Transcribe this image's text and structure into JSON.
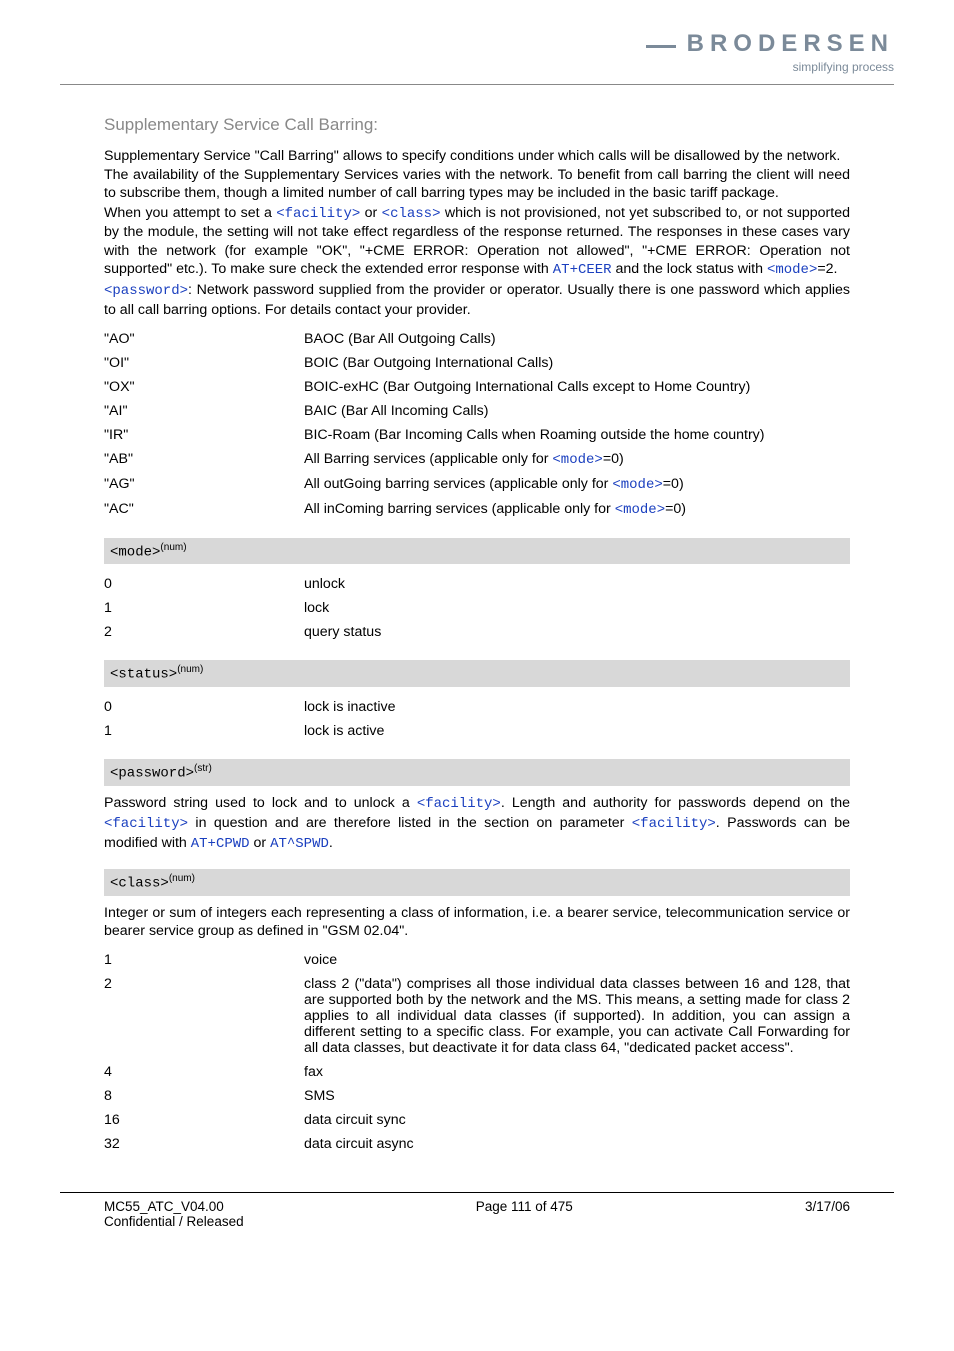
{
  "header": {
    "logo_text": "BRODERSEN",
    "tagline": "simplifying process"
  },
  "section": {
    "title": "Supplementary Service Call Barring:",
    "para1": "Supplementary Service \"Call Barring\" allows to specify conditions under which calls will be disallowed by the network.",
    "para2": "The availability of the Supplementary Services varies with the network. To benefit from call barring the client will need to subscribe them, though a limited number of call barring types may be included in the basic tariff package.",
    "para3a": "When you attempt to set a ",
    "para3_facility": "<facility>",
    "para3b": " or ",
    "para3_class": "<class>",
    "para3c": " which is not provisioned, not yet subscribed to, or not supported by the module, the setting will not take effect regardless of the response returned. The responses in these cases vary with the network (for example \"OK\", \"+CME ERROR: Operation not allowed\", \"+CME ERROR: Operation not supported\" etc.). To make sure check the extended error response with ",
    "para3_atceer": "AT+CEER",
    "para3d": " and the lock status with ",
    "para3_mode": "<mode>",
    "para3e": "=2.",
    "para4_pw": "<password>",
    "para4": ": Network password supplied from the provider or operator. Usually there is one password which applies to all call barring options. For details contact your provider."
  },
  "facility_table": [
    {
      "code": "\"AO\"",
      "desc": "BAOC (Bar All Outgoing Calls)"
    },
    {
      "code": "\"OI\"",
      "desc": "BOIC (Bar Outgoing International Calls)"
    },
    {
      "code": "\"OX\"",
      "desc": "BOIC-exHC (Bar Outgoing International Calls except to Home Country)"
    },
    {
      "code": "\"AI\"",
      "desc": "BAIC (Bar All Incoming Calls)"
    },
    {
      "code": "\"IR\"",
      "desc": "BIC-Roam (Bar Incoming Calls when Roaming outside the home country)"
    },
    {
      "code": "\"AB\"",
      "desc_pre": "All Barring services (applicable only for ",
      "mode": "<mode>",
      "desc_post": "=0)"
    },
    {
      "code": "\"AG\"",
      "desc_pre": "All outGoing barring services (applicable only for ",
      "mode": "<mode>",
      "desc_post": "=0)"
    },
    {
      "code": "\"AC\"",
      "desc_pre": "All inComing barring services (applicable only for ",
      "mode": "<mode>",
      "desc_post": "=0)"
    }
  ],
  "mode_header": {
    "token": "<mode>",
    "sup": "(num)"
  },
  "mode_table": [
    {
      "v": "0",
      "d": "unlock"
    },
    {
      "v": "1",
      "d": "lock"
    },
    {
      "v": "2",
      "d": "query status"
    }
  ],
  "status_header": {
    "token": "<status>",
    "sup": "(num)"
  },
  "status_table": [
    {
      "v": "0",
      "d": "lock is inactive"
    },
    {
      "v": "1",
      "d": "lock is active"
    }
  ],
  "password_header": {
    "token": "<password>",
    "sup": "(str)"
  },
  "password_para": {
    "a": "Password string used to lock and to unlock a ",
    "fac": "<facility>",
    "b": ". Length and authority for passwords depend on the ",
    "fac2": "<facility>",
    "c": " in question and are therefore listed in the section on parameter ",
    "fac3": "<facility>",
    "d": ". Passwords can be modified with ",
    "cpwd": "AT+CPWD",
    "or": " or ",
    "spwd": "AT^SPWD",
    "e": "."
  },
  "class_header": {
    "token": "<class>",
    "sup": "(num)"
  },
  "class_para": "Integer or sum of integers each representing a class of information, i.e. a bearer service, telecommunication service or bearer service group as defined in \"GSM 02.04\".",
  "class_table": [
    {
      "v": "1",
      "d": "voice"
    },
    {
      "v": "2",
      "d": "class 2 (\"data\") comprises all those individual data classes between 16 and 128, that are supported both by the network and the MS. This means, a setting made for class 2 applies to all individual data classes (if supported). In addition, you can assign a different setting to a specific class. For example, you can activate Call Forwarding for all data classes, but deactivate it for data class 64, \"dedicated packet access\"."
    },
    {
      "v": "4",
      "d": "fax"
    },
    {
      "v": "8",
      "d": "SMS"
    },
    {
      "v": "16",
      "d": "data circuit sync"
    },
    {
      "v": "32",
      "d": "data circuit async"
    }
  ],
  "footer": {
    "left1": "MC55_ATC_V04.00",
    "left2": "Confidential / Released",
    "center": "Page 111 of 475",
    "right": "3/17/06"
  }
}
